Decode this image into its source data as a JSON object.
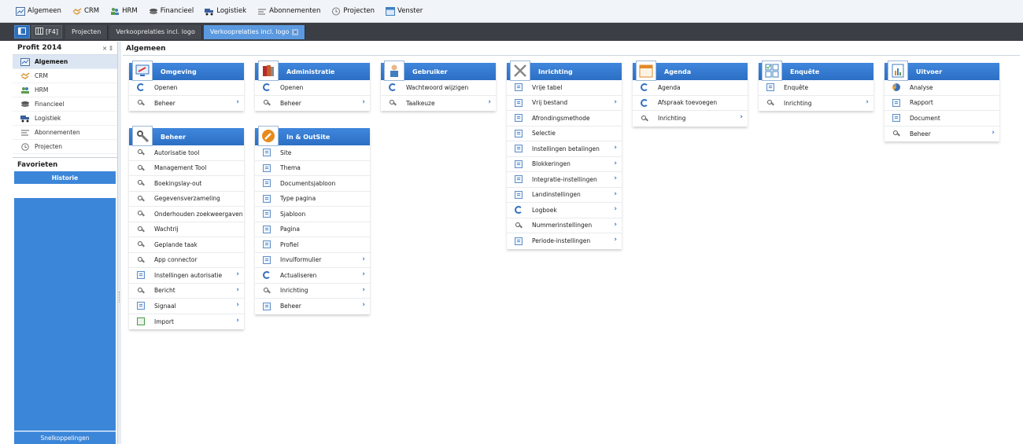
{
  "menubar": {
    "items": [
      {
        "label": "Algemeen",
        "icon": "dashboard-icon"
      },
      {
        "label": "CRM",
        "icon": "handshake-icon"
      },
      {
        "label": "HRM",
        "icon": "people-icon"
      },
      {
        "label": "Financieel",
        "icon": "coins-icon"
      },
      {
        "label": "Logistiek",
        "icon": "truck-icon"
      },
      {
        "label": "Abonnementen",
        "icon": "subscription-icon"
      },
      {
        "label": "Projecten",
        "icon": "clock-icon"
      },
      {
        "label": "Venster",
        "icon": "window-icon"
      }
    ]
  },
  "tabbar": {
    "btn1_label": "",
    "btn2_label": "[F4]",
    "tabs": [
      {
        "label": "Projecten"
      },
      {
        "label": "Verkooprelaties incl. logo"
      },
      {
        "label": "Verkooprelaties incl. logo",
        "active": true
      }
    ]
  },
  "sidebar": {
    "title": "Profit 2014",
    "pin_label": "× ‡",
    "items": [
      {
        "label": "Algemeen",
        "icon": "dashboard-icon",
        "selected": true
      },
      {
        "label": "CRM",
        "icon": "handshake-icon"
      },
      {
        "label": "HRM",
        "icon": "people-icon"
      },
      {
        "label": "Financieel",
        "icon": "coins-icon"
      },
      {
        "label": "Logistiek",
        "icon": "truck-icon"
      },
      {
        "label": "Abonnementen",
        "icon": "subscription-icon"
      },
      {
        "label": "Projecten",
        "icon": "clock-icon"
      }
    ],
    "favorites_title": "Favorieten",
    "history_tab": "Historie",
    "shortcuts_label": "Snelkoppelingen"
  },
  "main": {
    "title": "Algemeen",
    "panels": [
      {
        "title": "Omgeving",
        "icon": "monitor-icon",
        "rows": [
          {
            "label": "Openen",
            "icon": "open",
            "chev": false
          },
          {
            "label": "Beheer",
            "icon": "tool",
            "chev": true
          }
        ]
      },
      {
        "title": "Beheer",
        "icon": "tools-icon",
        "rows": [
          {
            "label": "Autorisatie tool",
            "icon": "tool",
            "chev": false
          },
          {
            "label": "Management Tool",
            "icon": "tool",
            "chev": false
          },
          {
            "label": "Boekingslay-out",
            "icon": "tool",
            "chev": false
          },
          {
            "label": "Gegevensverzameling",
            "icon": "tool",
            "chev": false
          },
          {
            "label": "Onderhouden zoekweergaven",
            "icon": "tool",
            "chev": false
          },
          {
            "label": "Wachtrij",
            "icon": "tool",
            "chev": false
          },
          {
            "label": "Geplande taak",
            "icon": "tool",
            "chev": false
          },
          {
            "label": "App connector",
            "icon": "tool",
            "chev": false
          },
          {
            "label": "Instellingen autorisatie",
            "icon": "doc",
            "chev": true
          },
          {
            "label": "Bericht",
            "icon": "tool",
            "chev": true
          },
          {
            "label": "Signaal",
            "icon": "doc",
            "chev": true
          },
          {
            "label": "Import",
            "icon": "import",
            "chev": true
          }
        ]
      },
      {
        "title": "Administratie",
        "icon": "books-icon",
        "rows": [
          {
            "label": "Openen",
            "icon": "open",
            "chev": false
          },
          {
            "label": "Beheer",
            "icon": "tool",
            "chev": true
          }
        ]
      },
      {
        "title": "In & OutSite",
        "icon": "compass-icon",
        "rows": [
          {
            "label": "Site",
            "icon": "doc",
            "chev": false
          },
          {
            "label": "Thema",
            "icon": "doc",
            "chev": false
          },
          {
            "label": "Documentsjabloon",
            "icon": "doc",
            "chev": false
          },
          {
            "label": "Type pagina",
            "icon": "doc",
            "chev": false
          },
          {
            "label": "Sjabloon",
            "icon": "doc",
            "chev": false
          },
          {
            "label": "Pagina",
            "icon": "doc",
            "chev": false
          },
          {
            "label": "Profiel",
            "icon": "doc",
            "chev": false
          },
          {
            "label": "Invulformulier",
            "icon": "doc",
            "chev": true
          },
          {
            "label": "Actualiseren",
            "icon": "open",
            "chev": true
          },
          {
            "label": "Inrichting",
            "icon": "tool",
            "chev": true
          },
          {
            "label": "Beheer",
            "icon": "doc",
            "chev": true
          }
        ]
      },
      {
        "title": "Gebruiker",
        "icon": "user-icon",
        "rows": [
          {
            "label": "Wachtwoord wijzigen",
            "icon": "open",
            "chev": false
          },
          {
            "label": "Taalkeuze",
            "icon": "tool",
            "chev": true
          }
        ]
      },
      {
        "title": "Inrichting",
        "icon": "wrench-icon",
        "rows": [
          {
            "label": "Vrije tabel",
            "icon": "doc",
            "chev": false
          },
          {
            "label": "Vrij bestand",
            "icon": "doc",
            "chev": true
          },
          {
            "label": "Afrondingsmethode",
            "icon": "doc",
            "chev": false
          },
          {
            "label": "Selectie",
            "icon": "doc",
            "chev": false
          },
          {
            "label": "Instellingen betalingen",
            "icon": "doc",
            "chev": true
          },
          {
            "label": "Blokkeringen",
            "icon": "doc",
            "chev": true
          },
          {
            "label": "Integratie-instellingen",
            "icon": "doc",
            "chev": true
          },
          {
            "label": "Landinstellingen",
            "icon": "doc",
            "chev": true
          },
          {
            "label": "Logboek",
            "icon": "open",
            "chev": true
          },
          {
            "label": "Nummerinstellingen",
            "icon": "tool",
            "chev": true
          },
          {
            "label": "Periode-instellingen",
            "icon": "doc",
            "chev": true
          }
        ]
      },
      {
        "title": "Agenda",
        "icon": "calendar-icon",
        "rows": [
          {
            "label": "Agenda",
            "icon": "open",
            "chev": false
          },
          {
            "label": "Afspraak toevoegen",
            "icon": "open",
            "chev": false
          },
          {
            "label": "Inrichting",
            "icon": "tool",
            "chev": true
          }
        ]
      },
      {
        "title": "Enquête",
        "icon": "checklist-icon",
        "rows": [
          {
            "label": "Enquête",
            "icon": "doc",
            "chev": false
          },
          {
            "label": "Inrichting",
            "icon": "tool",
            "chev": true
          }
        ]
      },
      {
        "title": "Uitvoer",
        "icon": "report-icon",
        "rows": [
          {
            "label": "Analyse",
            "icon": "chart",
            "chev": false
          },
          {
            "label": "Rapport",
            "icon": "doc",
            "chev": false
          },
          {
            "label": "Document",
            "icon": "doc",
            "chev": false
          },
          {
            "label": "Beheer",
            "icon": "tool",
            "chev": true
          }
        ]
      }
    ]
  },
  "colors": {
    "accent": "#2c6fc4",
    "tabbar": "#3b3f45",
    "sidebar_selected": "#dce6f3",
    "chevron": "#2a6fc7"
  }
}
